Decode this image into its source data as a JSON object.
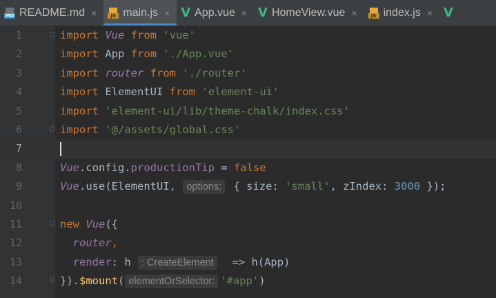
{
  "tabs": [
    {
      "label": "README.md",
      "icon": "markdown-file-icon",
      "close": "×",
      "active": false
    },
    {
      "label": "main.js",
      "icon": "javascript-file-icon",
      "close": "×",
      "active": true
    },
    {
      "label": "App.vue",
      "icon": "vue-file-icon",
      "close": "×",
      "active": false
    },
    {
      "label": "HomeView.vue",
      "icon": "vue-file-icon",
      "close": "×",
      "active": false
    },
    {
      "label": "index.js",
      "icon": "javascript-file-icon",
      "close": "×",
      "active": false
    },
    {
      "label": "",
      "icon": "vue-file-icon",
      "close": "",
      "active": false
    }
  ],
  "icon_badges": {
    "md": "MD",
    "js": "JS",
    "vue": "V"
  },
  "editor": {
    "current_line": 7,
    "lines": [
      {
        "num": "1",
        "tokens": [
          "import",
          "Vue",
          "from",
          "'vue'"
        ]
      },
      {
        "num": "2",
        "tokens": [
          "import",
          "App",
          "from",
          "'./App.vue'"
        ]
      },
      {
        "num": "3",
        "tokens": [
          "import",
          "router",
          "from",
          "'./router'"
        ]
      },
      {
        "num": "4",
        "tokens": [
          "import",
          "ElementUI",
          "from",
          "'element-ui'"
        ]
      },
      {
        "num": "5",
        "tokens": [
          "import",
          "'element-ui/lib/theme-chalk/index.css'"
        ]
      },
      {
        "num": "6",
        "tokens": [
          "import",
          "'@/assets/global.css'"
        ]
      },
      {
        "num": "7",
        "tokens": []
      },
      {
        "num": "8",
        "tokens": [
          "Vue",
          ".config.",
          "productionTip",
          " = ",
          "false"
        ]
      },
      {
        "num": "9",
        "tokens": [
          "Vue",
          ".",
          "use",
          "(ElementUI, ",
          "options:",
          " { size: ",
          "'small'",
          ", zIndex: ",
          "3000",
          " });"
        ]
      },
      {
        "num": "10",
        "tokens": []
      },
      {
        "num": "11",
        "tokens": [
          "new",
          "Vue",
          "({"
        ]
      },
      {
        "num": "12",
        "tokens": [
          "router",
          ","
        ]
      },
      {
        "num": "13",
        "tokens": [
          "render",
          ": h ",
          ": CreateElement",
          "  => h(App)"
        ]
      },
      {
        "num": "14",
        "tokens": [
          "}).",
          "$mount",
          "(",
          "elementOrSelector:",
          "'#app'",
          ")"
        ]
      }
    ]
  },
  "colors": {
    "background": "#2b2b2b",
    "keyword": "#cc7832",
    "string": "#6a8759",
    "number": "#6897bb",
    "identifier_purple": "#9876aa",
    "function": "#ffc66d",
    "tab_accent": "#4a88c7"
  }
}
